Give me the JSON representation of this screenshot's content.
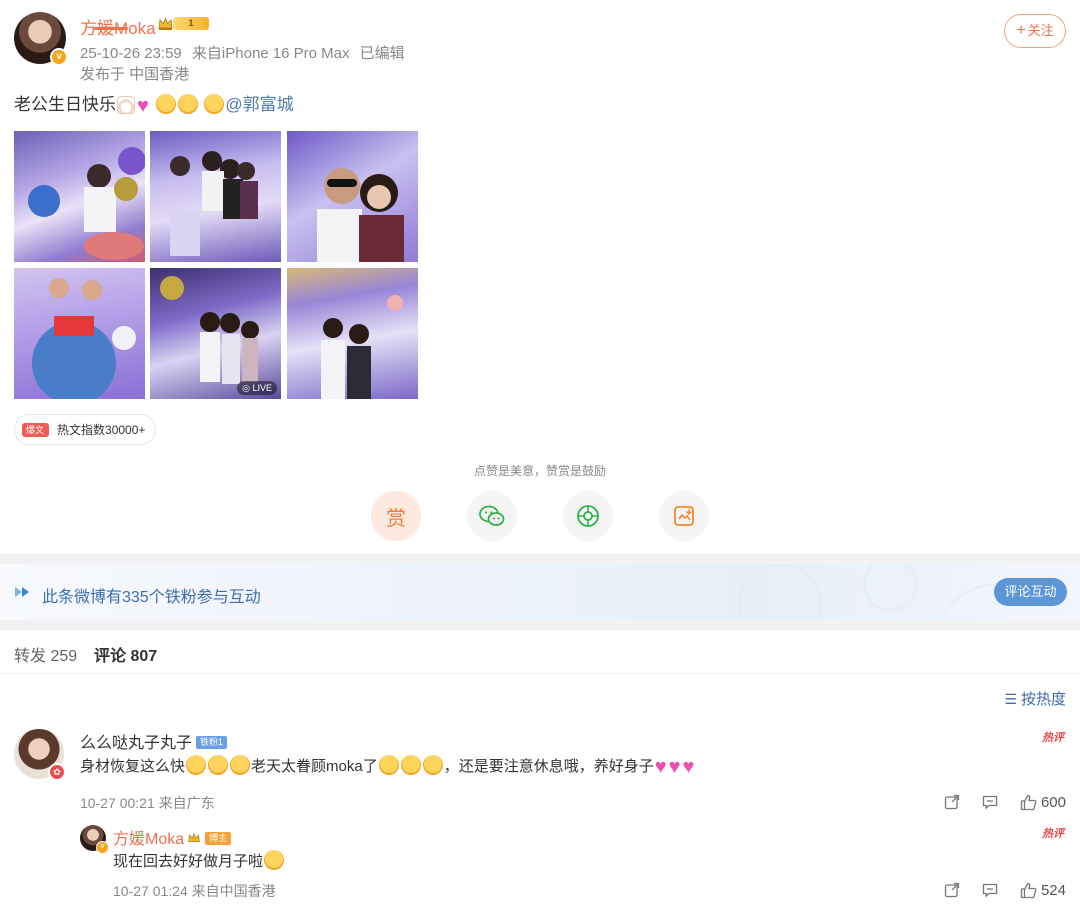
{
  "post": {
    "author": "方媛Moka",
    "author_level": "1",
    "date": "25-10-26 23:59",
    "source": "来自iPhone 16 Pro Max",
    "edited": "已编辑",
    "location": "发布于 中国香港",
    "follow_label": "关注",
    "text_prefix": "老公生日快乐",
    "mention": "@郭富城",
    "live_label": "LIVE",
    "hot_tag": "爆文",
    "hot_index": "热文指数30000+",
    "reward_tip": "点赞是美意，赞赏是鼓励",
    "reward_label": "赏"
  },
  "fans_banner": {
    "text": "此条微博有335个铁粉参与互动",
    "button": "评论互动"
  },
  "tabs": {
    "repost_label": "转发",
    "repost_count": "259",
    "comment_label": "评论",
    "comment_count": "807"
  },
  "sort_label": "按热度",
  "comments": [
    {
      "name": "么么哒丸子丸子",
      "fan_badge": "铁粉1",
      "text_a": "身材恢复这么快",
      "text_b": "老天太眷顾moka了",
      "text_c": "，还是要注意休息哦，养好身子",
      "time": "10-27 00:21 来自广东",
      "hot_tag": "热评",
      "likes": "600",
      "reply": {
        "name": "方媛Moka",
        "host_badge": "博主",
        "text": "现在回去好好做月子啦",
        "time": "10-27 01:24 来自中国香港",
        "hot_tag": "热评",
        "likes": "524"
      }
    }
  ],
  "colors": {
    "accent": "#eb7350",
    "link": "#507daf",
    "fans_text": "#3b6fb0",
    "button_blue": "#5b96d6"
  },
  "icons": {
    "avatar_verify": "verified-v-icon",
    "crown": "crown-icon",
    "reward": "reward-icon",
    "wechat": "wechat-icon",
    "moments": "moments-icon",
    "save_image": "save-image-icon",
    "sort": "sort-icon",
    "share": "share-icon",
    "comment": "comment-icon",
    "like": "thumbs-up-icon"
  }
}
